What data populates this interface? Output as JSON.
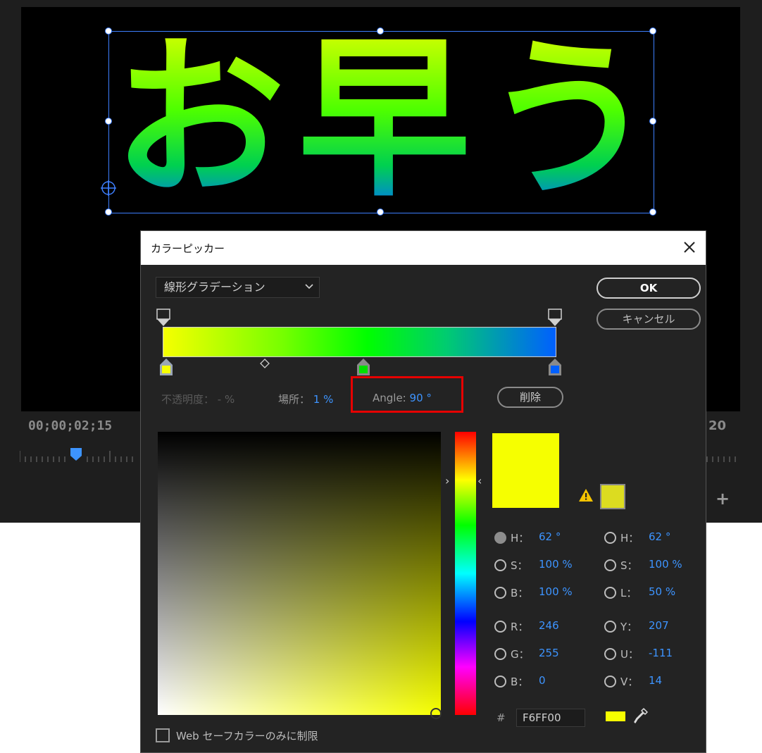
{
  "preview": {
    "title_text": "お早う",
    "timecode_left": "00;00;02;15",
    "timecode_right": "20",
    "plus_label": "+"
  },
  "dialog": {
    "title": "カラーピッカー",
    "gradient_type": "線形グラデーション",
    "ok_label": "OK",
    "cancel_label": "キャンセル",
    "delete_label": "削除",
    "opacity_label": "不透明度：",
    "opacity_value": "- %",
    "location_label": "場所：",
    "location_value": "1 %",
    "angle_label": "Angle:",
    "angle_value": "90 °",
    "hsb": {
      "h_label": "H：",
      "h_value": "62 °",
      "s_label": "S：",
      "s_value": "100 %",
      "b_label": "B：",
      "b_value": "100 %"
    },
    "hsl": {
      "h_label": "H：",
      "h_value": "62 °",
      "s_label": "S：",
      "s_value": "100 %",
      "l_label": "L：",
      "l_value": "50 %"
    },
    "rgb": {
      "r_label": "R：",
      "r_value": "246",
      "g_label": "G：",
      "g_value": "255",
      "b_label": "B：",
      "b_value": "0"
    },
    "yuv": {
      "y_label": "Y：",
      "y_value": "207",
      "u_label": "U：",
      "u_value": "-111",
      "v_label": "V：",
      "v_value": "14"
    },
    "hex_hash": "#",
    "hex_value": "F6FF00",
    "web_safe_label": "Web セーフカラーのみに制限",
    "colors": {
      "current": "#f6ff00",
      "previous": "#dcdc20",
      "accent": "#3d94ff",
      "highlight": "#e60000"
    }
  }
}
